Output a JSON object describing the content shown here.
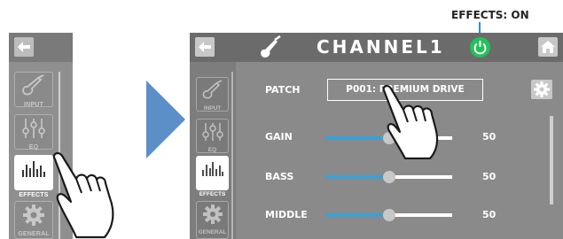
{
  "annotation": {
    "effects_status": "EFFECTS: ON"
  },
  "mini_panel": {
    "items": [
      {
        "label": "INPUT",
        "icon": "guitar-icon"
      },
      {
        "label": "EQ",
        "icon": "eq-icon"
      },
      {
        "label": "EFFECTS",
        "icon": "effects-icon"
      },
      {
        "label": "GENERAL",
        "icon": "gear-icon"
      }
    ]
  },
  "screen": {
    "title": "CHANNEL1",
    "sidebar": [
      {
        "label": "INPUT",
        "icon": "guitar-icon"
      },
      {
        "label": "EQ",
        "icon": "eq-icon"
      },
      {
        "label": "EFFECTS",
        "icon": "effects-icon"
      },
      {
        "label": "GENERAL",
        "icon": "gear-icon"
      }
    ],
    "patch": {
      "label": "PATCH",
      "value": "P001: PREMIUM DRIVE"
    },
    "params": [
      {
        "label": "GAIN",
        "value": "50",
        "level": 0.5
      },
      {
        "label": "BASS",
        "value": "50",
        "level": 0.5
      },
      {
        "label": "MIDDLE",
        "value": "50",
        "level": 0.5
      }
    ]
  },
  "colors": {
    "accent": "#3aa0d8",
    "power": "#22c25a",
    "arrow": "#5b8fc7"
  }
}
